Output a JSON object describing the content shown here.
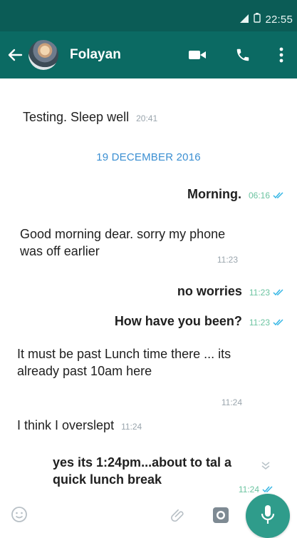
{
  "status_bar": {
    "time": "22:55",
    "signal_icon": "signal-icon",
    "battery_icon": "battery-icon"
  },
  "app_bar": {
    "contact_name": "Folayan",
    "icons": [
      "back-arrow-icon",
      "video-call-icon",
      "phone-icon",
      "more-vert-icon"
    ]
  },
  "chat": {
    "messages": [
      {
        "direction": "in",
        "text": "Testing. Sleep well",
        "time": "20:41"
      },
      {
        "type": "date",
        "text": "19 DECEMBER 2016"
      },
      {
        "direction": "out",
        "text": "Morning.",
        "time": "06:16",
        "status": "read"
      },
      {
        "direction": "in",
        "text": "Good morning dear. sorry my phone was off earlier",
        "time": "11:23"
      },
      {
        "direction": "out",
        "text": "no worries",
        "time": "11:23",
        "status": "read"
      },
      {
        "direction": "out",
        "text": "How have you been?",
        "time": "11:23",
        "status": "read"
      },
      {
        "direction": "in",
        "text": "It must be past Lunch time there ... its already past 10am here",
        "time": "11:24"
      },
      {
        "direction": "in",
        "text": "I think I overslept",
        "time": "11:24"
      },
      {
        "direction": "out",
        "text": "yes its 1:24pm...about to tal a quick lunch break",
        "time": "11:24",
        "status": "read"
      }
    ]
  },
  "input_bar": {
    "placeholder": "",
    "icons": [
      "emoji-icon",
      "attach-icon",
      "camera-icon",
      "mic-icon"
    ]
  },
  "colors": {
    "header": "#0b6a63",
    "status": "#0b5c56",
    "accent": "#2f9c8b",
    "date": "#3b8fd2",
    "read_ticks": "#35b6e5"
  }
}
